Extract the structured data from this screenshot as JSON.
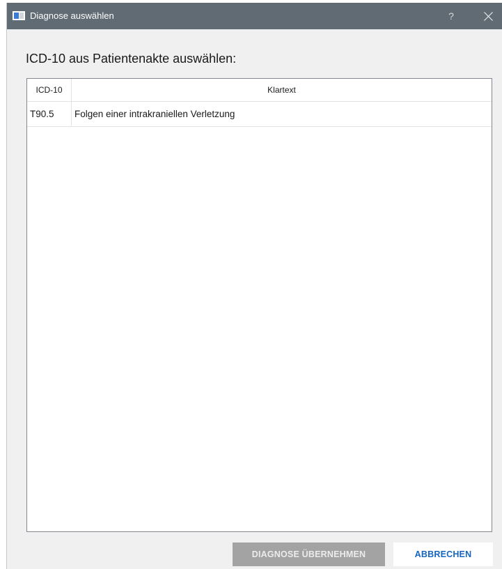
{
  "window": {
    "title": "Diagnose auswählen",
    "help_symbol": "?"
  },
  "prompt": "ICD-10 aus Patientenakte auswählen:",
  "table": {
    "columns": [
      "ICD-10",
      "Klartext"
    ],
    "rows": [
      {
        "code": "T90.5",
        "text": "Folgen einer intrakraniellen Verletzung"
      }
    ]
  },
  "buttons": {
    "apply_label": "DIAGNOSE ÜBERNEHMEN",
    "apply_enabled": false,
    "cancel_label": "ABBRECHEN"
  },
  "icons": {
    "app": "window-app-icon",
    "help": "help-icon",
    "close": "close-icon"
  },
  "colors": {
    "titlebar": "#616b73",
    "dialog_background": "#f0f0f0",
    "accent": "#1565c0",
    "disabled_button": "#a3a3a3"
  }
}
